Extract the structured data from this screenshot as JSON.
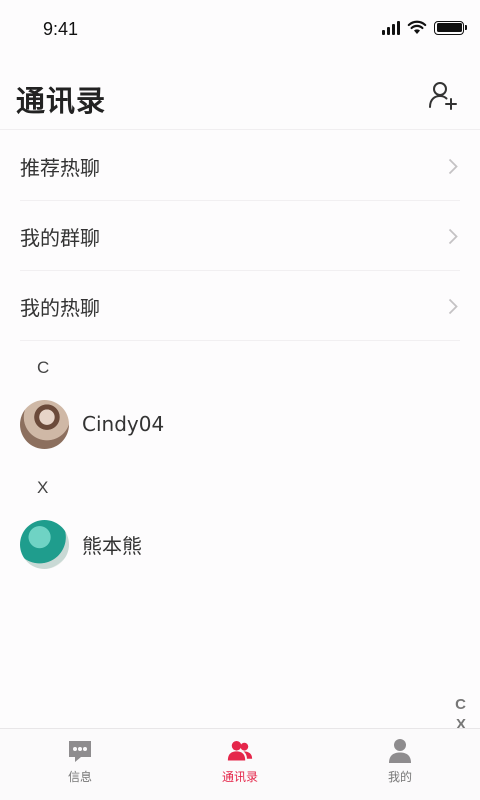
{
  "status_bar": {
    "time": "9:41"
  },
  "header": {
    "title": "通讯录",
    "add_icon": "add-user-icon"
  },
  "menu": [
    {
      "label": "推荐热聊",
      "icon": "chevron-right-icon"
    },
    {
      "label": "我的群聊",
      "icon": "chevron-right-icon"
    },
    {
      "label": "我的热聊",
      "icon": "chevron-right-icon"
    }
  ],
  "contacts": [
    {
      "letter": "C",
      "name": "Cindy04",
      "avatar": "avatar-photo"
    },
    {
      "letter": "X",
      "name": "熊本熊",
      "avatar": "avatar-photo"
    }
  ],
  "index": [
    "C",
    "X"
  ],
  "tabbar": {
    "active_color": "#e5264a",
    "tabs": [
      {
        "label": "信息",
        "icon": "chat-bubble-icon",
        "active": false
      },
      {
        "label": "通讯录",
        "icon": "contacts-icon",
        "active": true
      },
      {
        "label": "我的",
        "icon": "person-icon",
        "active": false
      }
    ]
  }
}
